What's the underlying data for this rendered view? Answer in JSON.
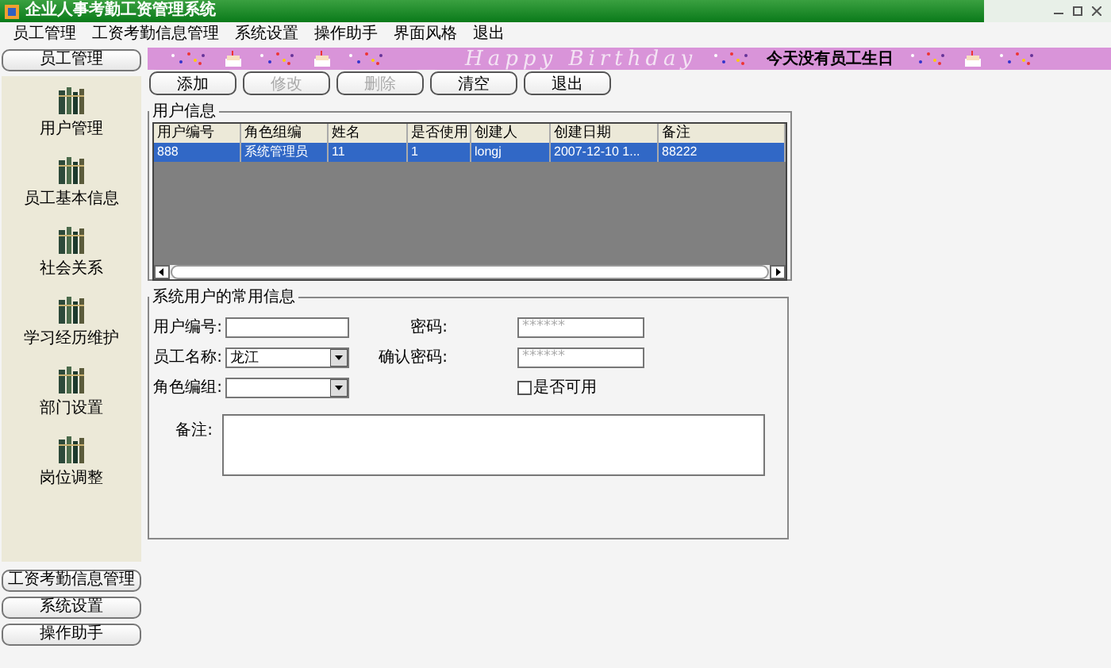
{
  "window": {
    "title": "企业人事考勤工资管理系统"
  },
  "menu": [
    "员工管理",
    "工资考勤信息管理",
    "系统设置",
    "操作助手",
    "界面风格",
    "退出"
  ],
  "sidebar": {
    "header": "员工管理",
    "items": [
      "用户管理",
      "员工基本信息",
      "社会关系",
      "学习经历维护",
      "部门设置",
      "岗位调整"
    ],
    "footer": [
      "工资考勤信息管理",
      "系统设置",
      "操作助手"
    ]
  },
  "banner": {
    "title": "Happy Birthday",
    "notice": "今天没有员工生日"
  },
  "buttons": [
    {
      "label": "添加",
      "disabled": false
    },
    {
      "label": "修改",
      "disabled": true
    },
    {
      "label": "删除",
      "disabled": true
    },
    {
      "label": "清空",
      "disabled": false
    },
    {
      "label": "退出",
      "disabled": false
    }
  ],
  "user_table": {
    "title": "用户信息",
    "columns": [
      "用户编号",
      "角色组编",
      "姓名",
      "是否使用",
      "创建人",
      "创建日期",
      "备注"
    ],
    "rows": [
      {
        "selected": true,
        "cells": [
          "888",
          "系统管理员",
          "11",
          "1",
          "longj",
          "2007-12-10 1...",
          "88222"
        ]
      }
    ]
  },
  "form": {
    "title": "系统用户的常用信息",
    "user_id": {
      "label": "用户编号:"
    },
    "password": {
      "label": "密码:",
      "placeholder": "******"
    },
    "employee": {
      "label": "员工名称:",
      "value": "龙江"
    },
    "confirm": {
      "label": "确认密码:",
      "placeholder": "******"
    },
    "role": {
      "label": "角色编组:"
    },
    "enabled": {
      "label": "是否可用",
      "checked": false
    },
    "note": {
      "label": "备注:"
    }
  }
}
